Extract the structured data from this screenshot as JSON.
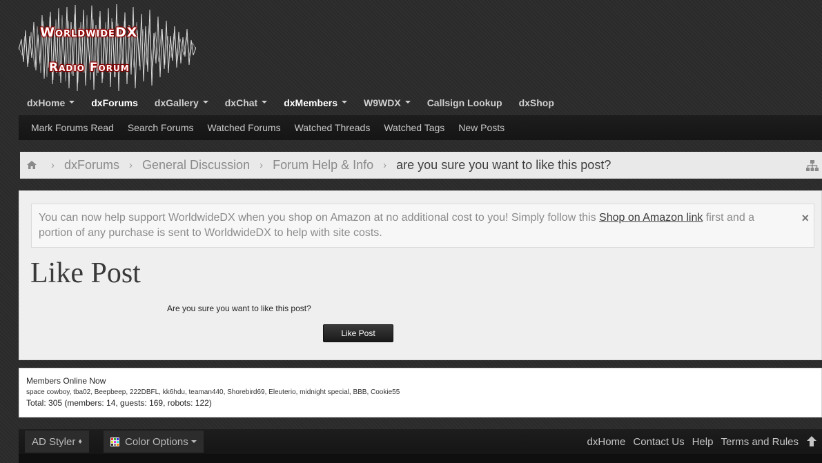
{
  "logo": {
    "line1": "WorldwideDX",
    "line2": "Radio Forum"
  },
  "mainnav": [
    {
      "label": "dxHome",
      "dropdown": true,
      "active": false
    },
    {
      "label": "dxForums",
      "dropdown": false,
      "active": true
    },
    {
      "label": "dxGallery",
      "dropdown": true,
      "active": false
    },
    {
      "label": "dxChat",
      "dropdown": true,
      "active": false
    },
    {
      "label": "dxMembers",
      "dropdown": true,
      "active": true
    },
    {
      "label": "W9WDX",
      "dropdown": true,
      "active": false
    },
    {
      "label": "Callsign Lookup",
      "dropdown": false,
      "active": false
    },
    {
      "label": "dxShop",
      "dropdown": false,
      "active": false
    }
  ],
  "subnav": [
    "Mark Forums Read",
    "Search Forums",
    "Watched Forums",
    "Watched Threads",
    "Watched Tags",
    "New Posts"
  ],
  "breadcrumb": {
    "items": [
      "dxForums",
      "General Discussion",
      "Forum Help & Info"
    ],
    "current": "are you sure you want to like this post?"
  },
  "notice": {
    "before_link": "You can now help support WorldwideDX when you shop on Amazon at no additional cost to you! Simply follow this ",
    "link": "Shop on Amazon link",
    "after_link": " first and a portion of any purchase is sent to WorldwideDX to help with site costs.",
    "close": "×"
  },
  "page": {
    "title": "Like Post",
    "confirm_text": "Are you sure you want to like this post?",
    "button": "Like Post"
  },
  "members_online": {
    "heading": "Members Online Now",
    "list": "space cowboy, tba02, Beepbeep, 222DBFL, kk6hdu, teaman440, Shorebird69, Eleuterio, midnight special, BBB, Cookie55",
    "total": "Total: 305 (members: 14, guests: 169, robots: 122)"
  },
  "footer": {
    "styler": "AD Styler",
    "color_options": "Color Options",
    "links": [
      "dxHome",
      "Contact Us",
      "Help",
      "Terms and Rules"
    ]
  },
  "colors": {
    "background": "#2b2b2b",
    "panel": "#efefef",
    "logo_red": "#b00000"
  }
}
